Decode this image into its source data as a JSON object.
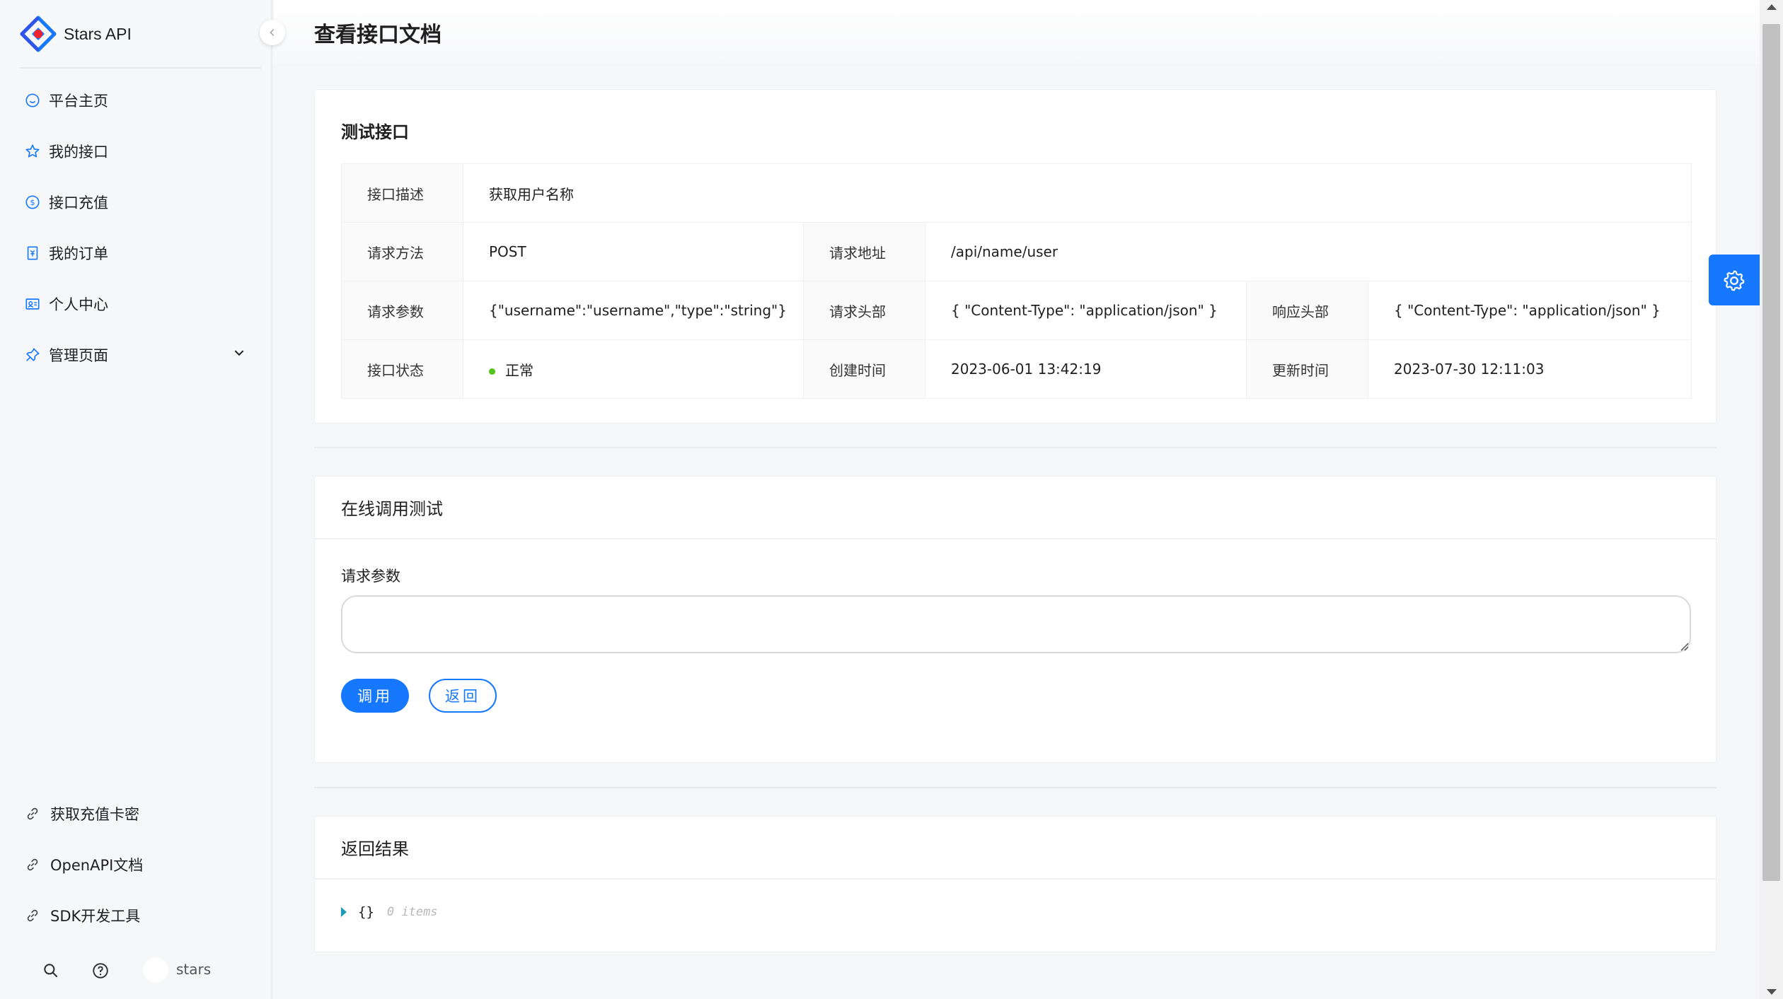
{
  "app": {
    "name": "Stars API"
  },
  "sidebar": {
    "items": [
      {
        "label": "平台主页",
        "icon": "smile-icon"
      },
      {
        "label": "我的接口",
        "icon": "star-icon"
      },
      {
        "label": "接口充值",
        "icon": "dollar-icon"
      },
      {
        "label": "我的订单",
        "icon": "order-icon"
      },
      {
        "label": "个人中心",
        "icon": "profile-icon"
      },
      {
        "label": "管理页面",
        "icon": "pushpin-icon"
      }
    ],
    "links": [
      {
        "label": "获取充值卡密",
        "icon": "link-icon"
      },
      {
        "label": "OpenAPI文档",
        "icon": "link-icon"
      },
      {
        "label": "SDK开发工具",
        "icon": "link-icon"
      }
    ],
    "user": {
      "name": "stars"
    }
  },
  "page": {
    "title": "查看接口文档"
  },
  "doc": {
    "title": "测试接口",
    "description_label": "接口描述",
    "description": "获取用户名称",
    "method_label": "请求方法",
    "method": "POST",
    "url_label": "请求地址",
    "url": "/api/name/user",
    "params_label": "请求参数",
    "params": "{\"username\":\"username\",\"type\":\"string\"}",
    "req_header_label": "请求头部",
    "req_header": "{ \"Content-Type\": \"application/json\" }",
    "resp_header_label": "响应头部",
    "resp_header": "{ \"Content-Type\": \"application/json\" }",
    "status_label": "接口状态",
    "status": "正常",
    "status_color": "#52c41a",
    "created_label": "创建时间",
    "created": "2023-06-01 13:42:19",
    "updated_label": "更新时间",
    "updated": "2023-07-30 12:11:03"
  },
  "invoke": {
    "title": "在线调用测试",
    "params_label": "请求参数",
    "params_value": "",
    "call_button": "调用",
    "back_button": "返回"
  },
  "result": {
    "title": "返回结果",
    "braces": "{}",
    "count": "0 items"
  },
  "colors": {
    "primary": "#1677ff"
  }
}
